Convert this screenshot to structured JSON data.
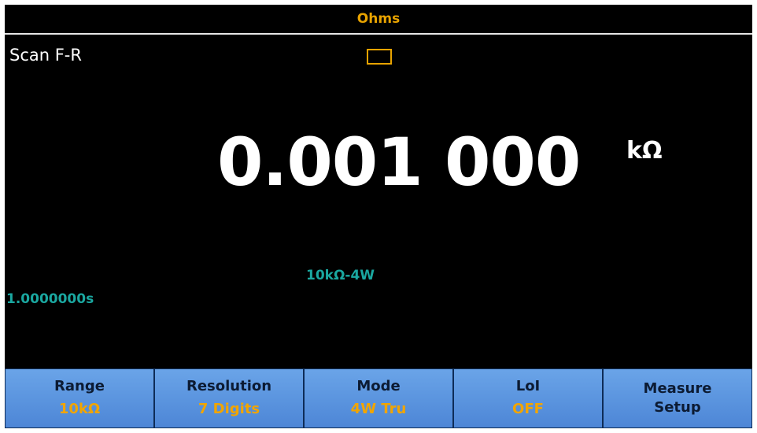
{
  "title": "Ohms",
  "scan_mode": "Scan F-R",
  "reading": {
    "value": "0.001 000",
    "unit": "kΩ"
  },
  "range_info": "10kΩ-4W",
  "timer": "1.0000000s",
  "softkeys": [
    {
      "label": "Range",
      "value": "10kΩ"
    },
    {
      "label": "Resolution",
      "value": "7 Digits"
    },
    {
      "label": "Mode",
      "value": "4W Tru"
    },
    {
      "label": "LoI",
      "value": "OFF"
    },
    {
      "label_line1": "Measure",
      "label_line2": "Setup"
    }
  ],
  "colors": {
    "title": "#e8a300",
    "info": "#1aa7a0",
    "softkey_bg": "#5a94dd",
    "softkey_value": "#f1a500"
  }
}
